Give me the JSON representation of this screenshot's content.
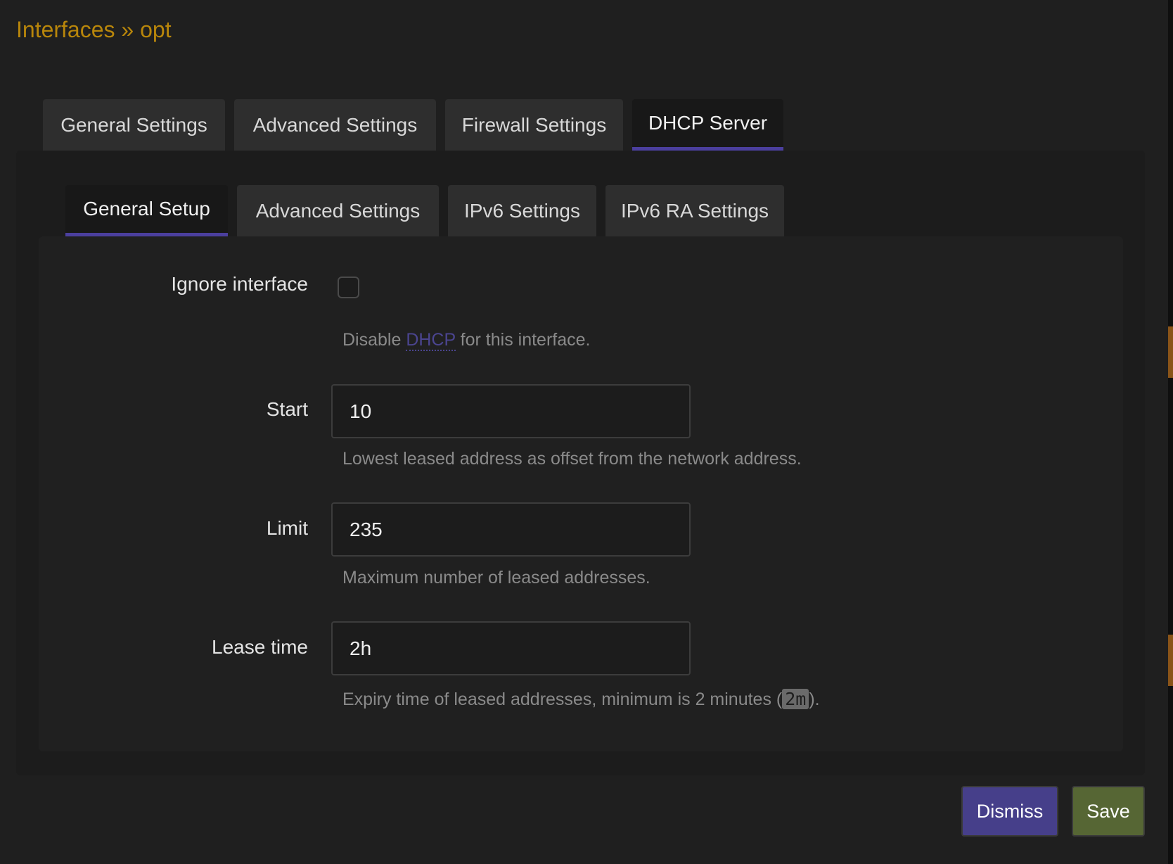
{
  "header": {
    "title": "Interfaces » opt"
  },
  "outer_tabs": [
    {
      "label": "General Settings",
      "active": false
    },
    {
      "label": "Advanced Settings",
      "active": false
    },
    {
      "label": "Firewall Settings",
      "active": false
    },
    {
      "label": "DHCP Server",
      "active": true
    }
  ],
  "inner_tabs": [
    {
      "label": "General Setup",
      "active": true
    },
    {
      "label": "Advanced Settings",
      "active": false
    },
    {
      "label": "IPv6 Settings",
      "active": false
    },
    {
      "label": "IPv6 RA Settings",
      "active": false
    }
  ],
  "form": {
    "ignore": {
      "label": "Ignore interface",
      "checked": false,
      "help_pre": "Disable ",
      "help_link": "DHCP",
      "help_post": " for this interface."
    },
    "start": {
      "label": "Start",
      "value": "10",
      "help": "Lowest leased address as offset from the network address."
    },
    "limit": {
      "label": "Limit",
      "value": "235",
      "help": "Maximum number of leased addresses."
    },
    "leasetime": {
      "label": "Lease time",
      "value": "2h",
      "help_pre": "Expiry time of leased addresses, minimum is 2 minutes (",
      "help_code": "2m",
      "help_post": ")."
    }
  },
  "buttons": {
    "dismiss": "Dismiss",
    "save": "Save"
  },
  "colors": {
    "accent": "#4b3f9e",
    "title": "#b8860b",
    "dismiss": "#463f8a",
    "save": "#566634"
  }
}
